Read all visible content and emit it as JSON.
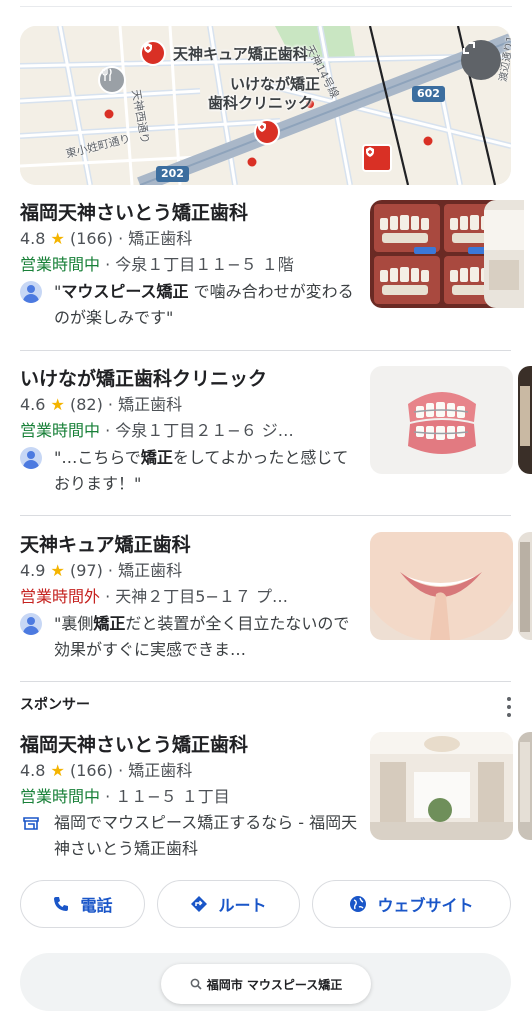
{
  "map": {
    "labels": {
      "cure": "天神キュア矯正歯科",
      "ikenaga_line1": "いけなが矯正",
      "ikenaga_line2": "歯科クリニック"
    },
    "streets": {
      "tenjin14": "天神14号線",
      "tenjinnishi": "天神西通り",
      "higashikoji": "東小姓町通り",
      "watanabe": "渡辺通り146号線"
    },
    "routes": {
      "r602": "602",
      "r202": "202"
    }
  },
  "listings": [
    {
      "name": "福岡天神さいとう矯正歯科",
      "rating": "4.8",
      "star": "★",
      "reviews": "(166)",
      "category": "矯正歯科",
      "status": "営業時間中",
      "address": "今泉１丁目１１−５ １階",
      "review_open_quote": "\"",
      "review_bold": "マウスピース矯正",
      "review_rest": " で噛み合わせが変わるのが楽しみです\""
    },
    {
      "name": "いけなが矯正歯科クリニック",
      "rating": "4.6",
      "star": "★",
      "reviews": "(82)",
      "category": "矯正歯科",
      "status": "営業時間中",
      "address": "今泉１丁目２１−６ ジ…",
      "review_prefix": "\"…こちらで",
      "review_bold": "矯正",
      "review_rest": "をしてよかったと感じております！\""
    },
    {
      "name": "天神キュア矯正歯科",
      "rating": "4.9",
      "star": "★",
      "reviews": "(97)",
      "category": "矯正歯科",
      "status": "営業時間外",
      "address": "天神２丁目5−１７ プ…",
      "review_prefix": "\"裏側",
      "review_bold": "矯正",
      "review_rest": "だと装置が全く目立たないので効果がすぐに実感できま…"
    }
  ],
  "sponsored": {
    "label": "スポンサー",
    "name": "福岡天神さいとう矯正歯科",
    "rating": "4.8",
    "star": "★",
    "reviews": "(166)",
    "category": "矯正歯科",
    "status": "営業時間中",
    "address": "１１−５ １丁目",
    "ad_text": "福岡でマウスピース矯正するなら - 福岡天神さいとう矯正歯科"
  },
  "actions": {
    "call": "電話",
    "route": "ルート",
    "website": "ウェブサイト"
  },
  "bottom_search": {
    "query": "福岡市 マウスピース矯正"
  },
  "sep": "·",
  "colors": {
    "open": "#188038",
    "closed": "#c5221f",
    "star": "#f4b400",
    "link_blue": "#1a56c8",
    "pin_red": "#d93025"
  }
}
